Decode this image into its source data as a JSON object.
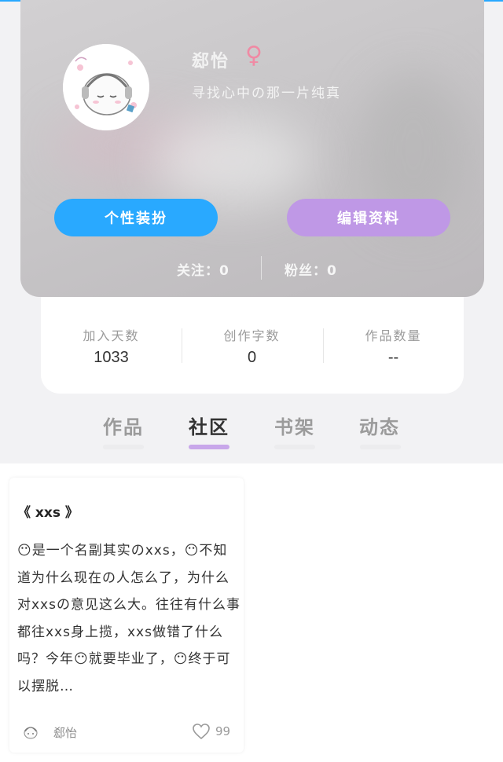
{
  "profile": {
    "username": "郄怡",
    "gender_icon": "female-icon",
    "gender_symbol": "♀",
    "signature": "寻找心中の那一片纯真",
    "dress_button": "个性装扮",
    "edit_button": "编辑资料",
    "following": "关注：0",
    "fans": "粉丝：0"
  },
  "stats": [
    {
      "label": "加入天数",
      "value": "1033"
    },
    {
      "label": "创作字数",
      "value": "0"
    },
    {
      "label": "作品数量",
      "value": "--"
    }
  ],
  "tabs": [
    {
      "label": "作品",
      "active": false
    },
    {
      "label": "社区",
      "active": true
    },
    {
      "label": "书架",
      "active": false
    },
    {
      "label": "动态",
      "active": false
    }
  ],
  "post": {
    "title": "《 xxs 》",
    "body": "😶是一个名副其实のxxs，😶不知道为什么现在の人怎么了，为什么对xxsの意见这么大。往往有什么事都往xxs身上揽，xxs做错了什么吗？今年😶就要毕业了，😶终于可以摆脱…",
    "author": "郄怡",
    "likes": "99"
  },
  "colors": {
    "accent_blue": "#29a9ff",
    "accent_purple": "#bf98e6",
    "tab_active_underline": "#c8a7ea",
    "female": "#f08aa4"
  }
}
